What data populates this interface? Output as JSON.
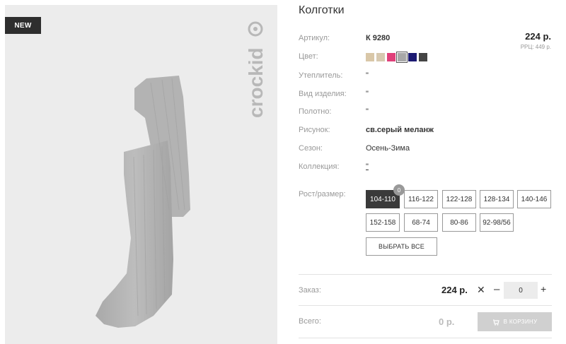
{
  "product": {
    "title": "Колготки",
    "badge": "NEW",
    "brand": "crockid",
    "photo_alt": "",
    "price": "224 р.",
    "rrp": "РРЦ: 449 р."
  },
  "attributes": [
    {
      "label": "Артикул:",
      "value": "К 9280",
      "bold": true
    },
    {
      "label": "Цвет:",
      "value": ""
    },
    {
      "label": "Утеплитель:",
      "value": "\""
    },
    {
      "label": "Вид изделия:",
      "value": "\""
    },
    {
      "label": "Полотно:",
      "value": "\""
    },
    {
      "label": "Рисунок:",
      "value": "св.серый меланж",
      "bold": true
    },
    {
      "label": "Сезон:",
      "value": "Осень-Зима"
    },
    {
      "label": "Коллекция:",
      "value": "\""
    }
  ],
  "colors": [
    {
      "name": "beige",
      "hex": "#d9c7a8",
      "selected": false
    },
    {
      "name": "light-beige",
      "hex": "#d7c9b0",
      "selected": false
    },
    {
      "name": "pink",
      "hex": "#e0407a",
      "selected": false
    },
    {
      "name": "light-grey",
      "hex": "#a8a8a8",
      "selected": true
    },
    {
      "name": "navy",
      "hex": "#1c1a72",
      "selected": false
    },
    {
      "name": "dark-grey",
      "hex": "#444444",
      "selected": false
    }
  ],
  "size_label": "Рост/размер:",
  "sizes": [
    {
      "label": "104-110",
      "active": true,
      "count": "0"
    },
    {
      "label": "116-122"
    },
    {
      "label": "122-128"
    },
    {
      "label": "128-134"
    },
    {
      "label": "140-146"
    },
    {
      "label": "152-158"
    },
    {
      "label": "68-74"
    },
    {
      "label": "80-86"
    },
    {
      "label": "92-98/56"
    }
  ],
  "select_all_label": "ВЫБРАТЬ ВСЕ",
  "order": {
    "label": "Заказ:",
    "price": "224 р.",
    "times": "✕",
    "minus": "–",
    "quantity": "0",
    "plus": "+"
  },
  "total": {
    "label": "Всего:",
    "value": "0 р.",
    "cart_label": "В КОРЗИНУ"
  },
  "theme": {
    "active_size_bg": "#3a3a3a",
    "cart_btn_bg": "#d0d0d0",
    "image_bg": "#ececec"
  }
}
